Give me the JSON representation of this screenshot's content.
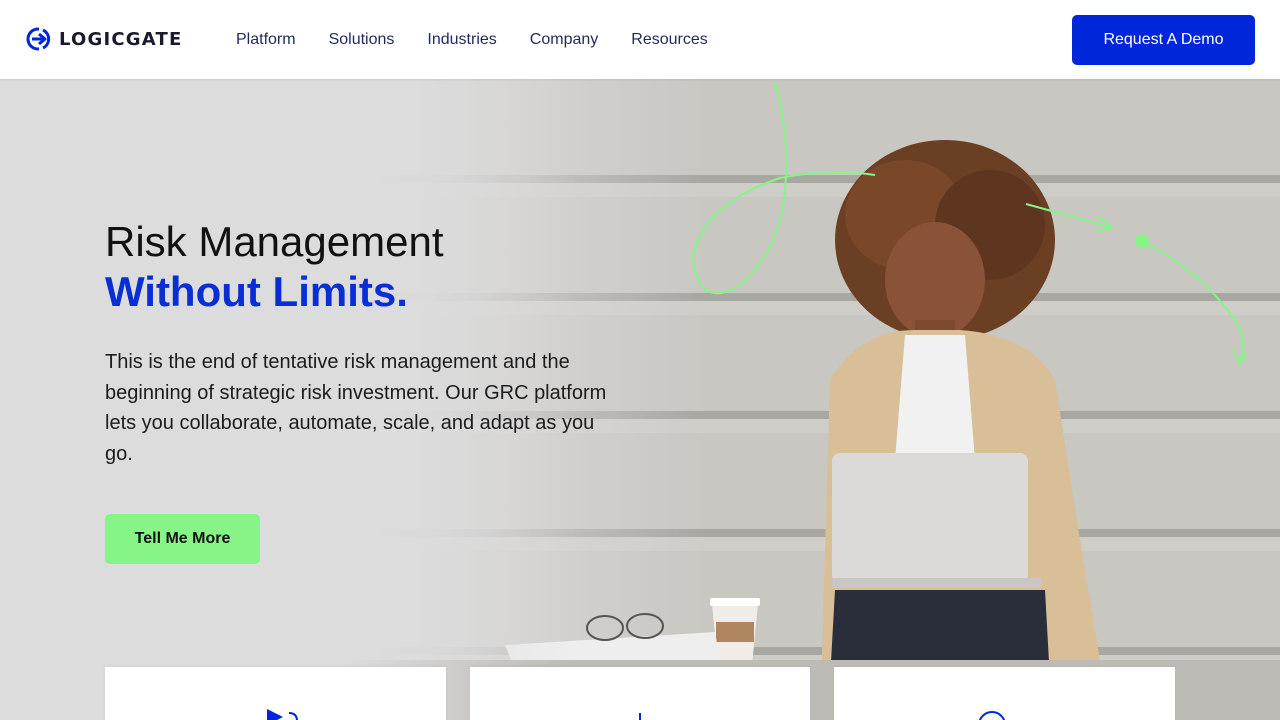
{
  "brand": {
    "name": "LOGICGATE",
    "color": "#0026d9"
  },
  "nav": {
    "items": [
      {
        "label": "Platform"
      },
      {
        "label": "Solutions"
      },
      {
        "label": "Industries"
      },
      {
        "label": "Company"
      },
      {
        "label": "Resources"
      }
    ],
    "cta_label": "Request A Demo"
  },
  "hero": {
    "title_line1": "Risk Management",
    "title_line2": "Without Limits.",
    "description": "This is the end of tentative risk management and the beginning of strategic risk investment. Our GRC platform lets you collaborate, automate, scale, and adapt as you go.",
    "cta_label": "Tell Me More",
    "accent_green": "#86f486"
  },
  "cards": [
    {
      "icon": "play-icon"
    },
    {
      "icon": "plus-icon"
    },
    {
      "icon": "circle-icon"
    }
  ]
}
